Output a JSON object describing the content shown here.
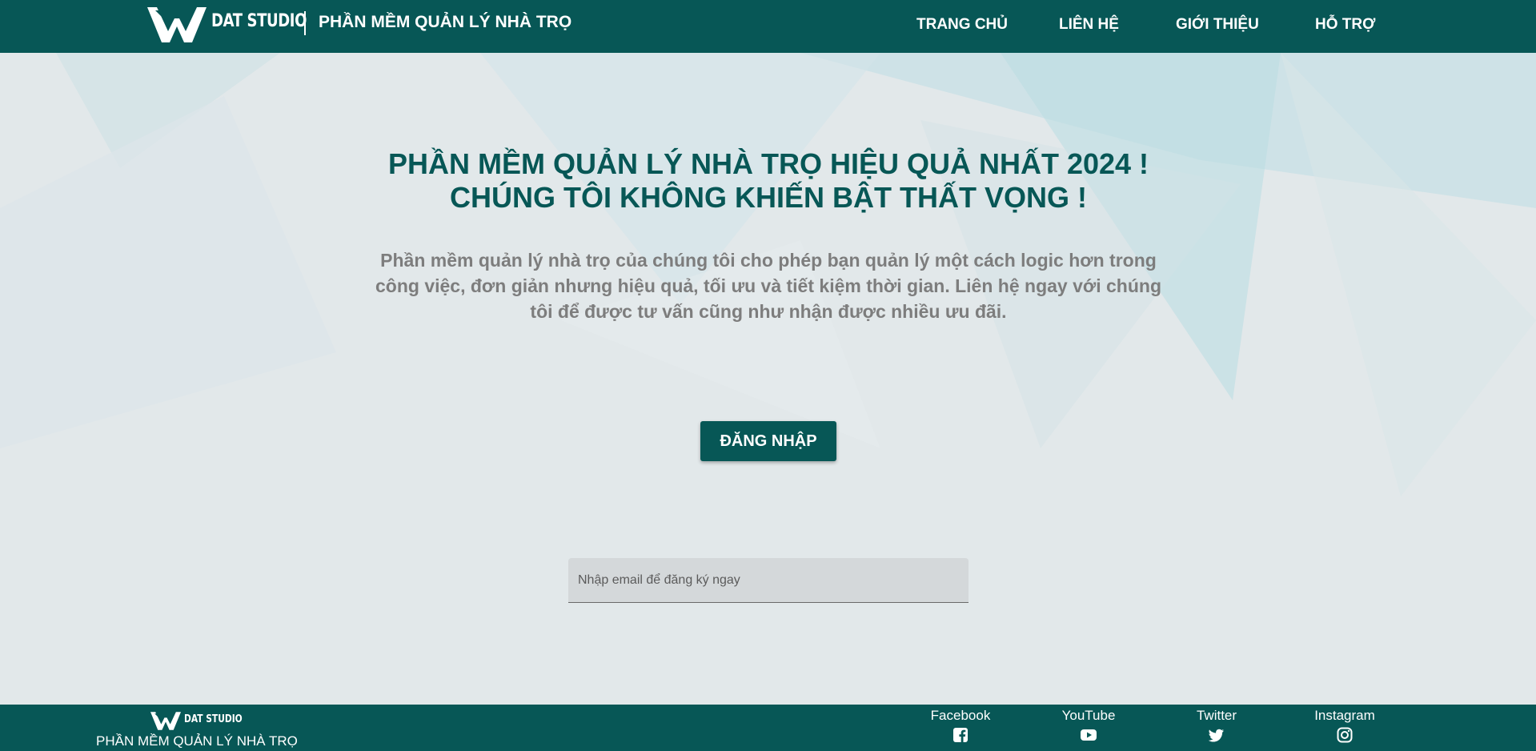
{
  "header": {
    "brand": "DAT STUDIO",
    "app_title": "PHẦN MỀM QUẢN LÝ NHÀ TRỌ",
    "nav": [
      {
        "label": "TRANG CHỦ"
      },
      {
        "label": "LIÊN HỆ"
      },
      {
        "label": "GIỚI THIỆU"
      },
      {
        "label": "HỖ TRỢ"
      }
    ]
  },
  "hero": {
    "title_line1": "PHẦN MỀM QUẢN LÝ NHÀ TRỌ HIỆU QUẢ NHẤT 2024 !",
    "title_line2": "CHÚNG TÔI KHÔNG KHIẾN BẬT THẤT VỌNG !",
    "description": "Phần mềm quản lý nhà trọ của chúng tôi cho phép bạn quản lý một cách logic hơn trong công việc, đơn giản nhưng hiệu quả, tối ưu và tiết kiệm thời gian. Liên hệ ngay với chúng tôi để được tư vấn cũng như nhận được nhiều ưu đãi.",
    "login_button": "ĐĂNG NHẬP",
    "email_placeholder": "Nhập email để đăng ký ngay",
    "email_value": ""
  },
  "footer": {
    "brand": "DAT STUDIO",
    "app_name": "PHẦN MỀM QUẢN LÝ NHÀ TRỌ",
    "social": [
      {
        "label": "Facebook",
        "icon": "facebook-icon"
      },
      {
        "label": "YouTube",
        "icon": "youtube-icon"
      },
      {
        "label": "Twitter",
        "icon": "twitter-icon"
      },
      {
        "label": "Instagram",
        "icon": "instagram-icon"
      }
    ]
  },
  "colors": {
    "primary": "#075756",
    "background": "#e2e8ea",
    "description_text": "#7d7d7d"
  }
}
